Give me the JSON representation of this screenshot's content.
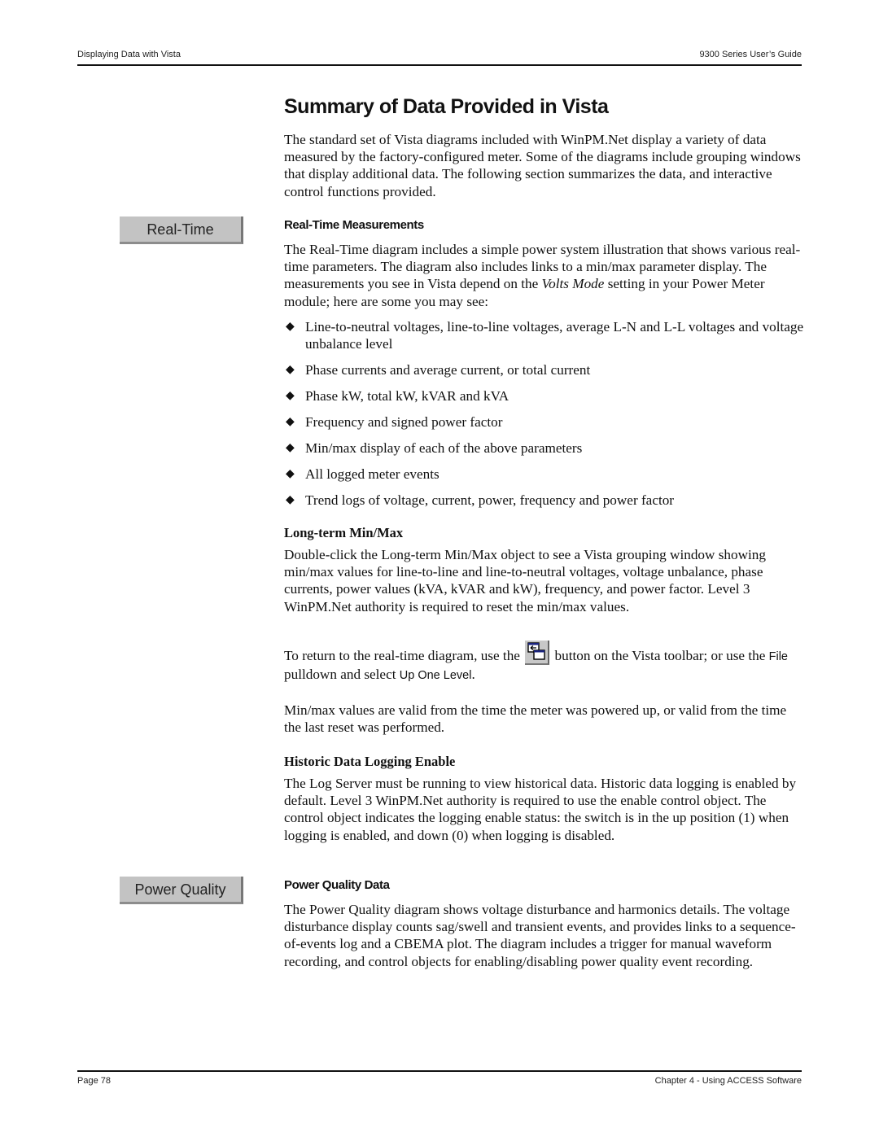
{
  "header": {
    "left": "Displaying Data with Vista",
    "right": "9300 Series User’s Guide"
  },
  "footer": {
    "left": "Page 78",
    "right": "Chapter 4 - Using ACCESS Software"
  },
  "title": "Summary of Data Provided in Vista",
  "intro": "The standard set of Vista diagrams included with WinPM.Net display a variety of data measured by the factory-configured meter. Some of the diagrams include grouping windows that display additional data. The following section summarizes the data, and interactive control functions provided.",
  "buttons": {
    "real_time": "Real-Time",
    "power_quality": "Power Quality"
  },
  "real_time": {
    "heading": "Real-Time Measurements",
    "para_before": "The Real-Time diagram includes a simple power system illustration that shows various real-time parameters. The diagram also includes links to a min/max parameter display. The measurements you see in Vista depend on the ",
    "para_italic": "Volts Mode",
    "para_after": " setting in your Power Meter module; here are some you may see:",
    "bullets": [
      "Line-to-neutral voltages, line-to-line voltages, average L-N and L-L voltages and voltage unbalance level",
      "Phase currents and average current, or total current",
      "Phase kW, total kW, kVAR and kVA",
      "Frequency and signed power factor",
      "Min/max display of each of the above parameters",
      "All logged meter events",
      "Trend logs of voltage, current, power, frequency and power factor"
    ]
  },
  "long_term": {
    "heading": "Long-term Min/Max",
    "para": "Double-click the Long-term Min/Max object to see a Vista grouping window showing min/max values for line-to-line and line-to-neutral voltages, voltage unbalance, phase currents, power values (kVA, kVAR and kW), frequency, and power factor. Level 3 WinPM.Net authority is required to reset the min/max values.",
    "return_1": "To return to the real-time diagram, use the",
    "return_icon": "up-one-level-icon",
    "return_2": "button on the Vista toolbar; or use the",
    "return_file": "File",
    "return_3": "pulldown and select",
    "return_menu": "Up One Level",
    "return_end": ".",
    "validity": "Min/max values are valid from the time the meter was powered up, or valid from the time the last reset was performed."
  },
  "historic": {
    "heading": "Historic Data Logging Enable",
    "para": "The Log Server must be running to view historical data. Historic data logging is enabled by default. Level 3 WinPM.Net authority is required to use the enable control object. The control object indicates the logging enable status: the switch is in the up position (1) when logging is enabled, and down (0) when logging is disabled."
  },
  "power_quality": {
    "heading": "Power Quality Data",
    "para": "The Power Quality diagram shows voltage disturbance and harmonics details. The voltage disturbance display counts sag/swell and transient events, and provides links to a sequence-of-events log and a CBEMA plot. The diagram includes a trigger for manual waveform recording, and control objects for enabling/disabling power quality event recording."
  },
  "bullet_glyph": "◆"
}
